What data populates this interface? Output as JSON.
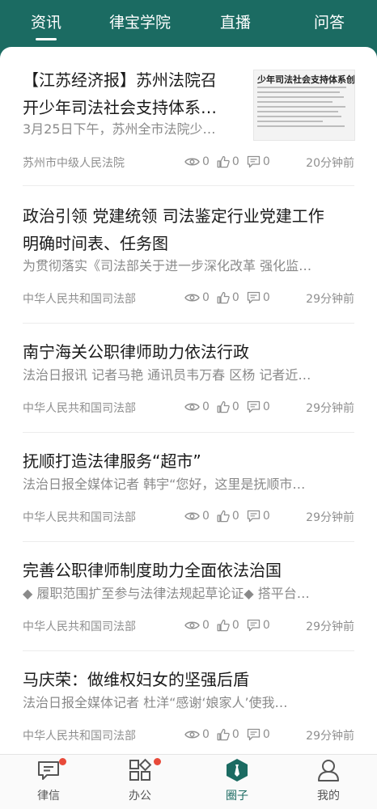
{
  "top_tabs": [
    "资讯",
    "律宝学院",
    "直播",
    "问答"
  ],
  "active_top_tab": "资讯",
  "articles": [
    {
      "title_line1": "【江苏经济报】苏州法院召",
      "title_line2": "开少年司法社会支持体系…",
      "summary": "3月25日下午，苏州全市法院少…",
      "source": "苏州市中级人民法院",
      "views": "0",
      "likes": "0",
      "comments": "0",
      "time": "20分钟前",
      "thumbnail_headline": "少年司法社会支持体系创建"
    },
    {
      "title_line1": "政治引领 党建统领 司法鉴定行业党建工作",
      "title_line2": "明确时间表、任务图",
      "summary": "为贯彻落实《司法部关于进一步深化改革 强化监…",
      "source": "中华人民共和国司法部",
      "views": "0",
      "likes": "0",
      "comments": "0",
      "time": "29分钟前"
    },
    {
      "title_line1": "南宁海关公职律师助力依法行政",
      "summary": "法治日报讯 记者马艳 通讯员韦万春 区杨 记者近…",
      "source": "中华人民共和国司法部",
      "views": "0",
      "likes": "0",
      "comments": "0",
      "time": "29分钟前"
    },
    {
      "title_line1": "抚顺打造法律服务“超市”",
      "summary": "法治日报全媒体记者 韩宇“您好，这里是抚顺市…",
      "source": "中华人民共和国司法部",
      "views": "0",
      "likes": "0",
      "comments": "0",
      "time": "29分钟前"
    },
    {
      "title_line1": "完善公职律师制度助力全面依法治国",
      "summary": "◆ 履职范围扩至参与法律法规起草论证◆ 搭平台…",
      "source": "中华人民共和国司法部",
      "views": "0",
      "likes": "0",
      "comments": "0",
      "time": "29分钟前"
    },
    {
      "title_line1": "马庆荣：做维权妇女的坚强后盾",
      "summary": "法治日报全媒体记者 杜洋“感谢‘娘家人’使我…",
      "source": "中华人民共和国司法部",
      "views": "0",
      "likes": "0",
      "comments": "0",
      "time": "29分钟前"
    }
  ],
  "bottom_tabs": [
    {
      "label": "律信",
      "icon": "message-icon",
      "badge": true
    },
    {
      "label": "办公",
      "icon": "apps-icon",
      "badge": true
    },
    {
      "label": "圈子",
      "icon": "circle-tie-icon",
      "badge": false
    },
    {
      "label": "我的",
      "icon": "person-icon",
      "badge": false
    }
  ],
  "active_bottom_tab": "圈子",
  "colors": {
    "accent": "#1b6b62",
    "badge": "#e84a3a"
  }
}
